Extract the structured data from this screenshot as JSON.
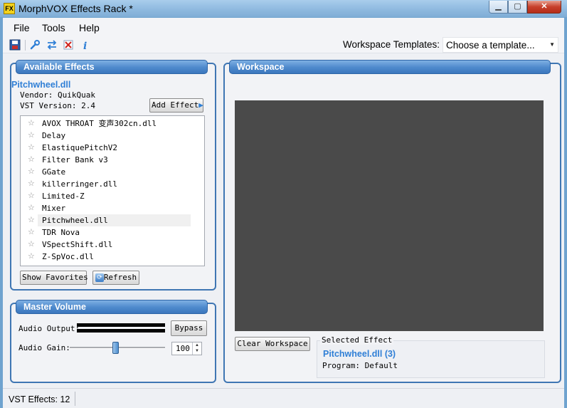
{
  "window": {
    "title": "MorphVOX Effects Rack *",
    "icon_text": "FX"
  },
  "menu": {
    "file": "File",
    "tools": "Tools",
    "help": "Help"
  },
  "toolbar": {
    "icons": [
      "save-icon",
      "wrench-icon",
      "swap-icon",
      "remove-icon",
      "info-icon"
    ],
    "templates_label": "Workspace Templates:",
    "templates_value": "Choose a template..."
  },
  "effects_panel": {
    "title": "Available Effects",
    "selected_name": "Pitchwheel.dll",
    "vendor": "Vendor: QuikQuak",
    "version": "VST Version: 2.4",
    "add_label": "Add Effect",
    "items": [
      "AVOX THROAT 变声302cn.dll",
      "Delay",
      "ElastiquePitchV2",
      "Filter Bank v3",
      "GGate",
      "killerringer.dll",
      "Limited-Z",
      "Mixer",
      "Pitchwheel.dll",
      "TDR Nova",
      "VSpectShift.dll",
      "Z-SpVoc.dll"
    ],
    "selected_index": 8,
    "show_favorites_label": "Show Favorites",
    "refresh_label": "Refresh"
  },
  "volume_panel": {
    "title": "Master Volume",
    "output_label": "Audio Output:",
    "bypass_label": "Bypass",
    "gain_label": "Audio Gain:",
    "gain_value": "100"
  },
  "workspace_panel": {
    "title": "Workspace",
    "clear_label": "Clear Workspace",
    "selected_legend": "Selected Effect",
    "selected_name": "Pitchwheel.dll (3)",
    "selected_program": "Program: Default"
  },
  "statusbar": {
    "text": "VST Effects: 12"
  },
  "colors": {
    "accent": "#3f76b3",
    "link_blue": "#2f7fd6",
    "workspace_bg": "#4a4a4a"
  }
}
